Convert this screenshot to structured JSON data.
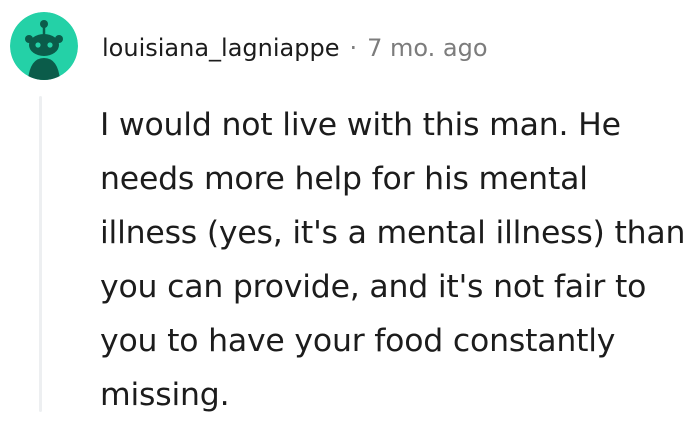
{
  "comment": {
    "author": "louisiana_lagniappe",
    "separator": "·",
    "timestamp": "7 mo. ago",
    "avatar_icon": "reddit-snoo-avatar-icon",
    "avatar_bg_color": "#24d1a7",
    "avatar_figure_color": "#0b5c4a",
    "body_lines": [
      "I would not live with this man. He",
      "needs more help for his mental",
      "illness (yes, it's a mental illness) than",
      "you can provide, and it's not fair to",
      "you to have your food constantly",
      "missing."
    ]
  }
}
